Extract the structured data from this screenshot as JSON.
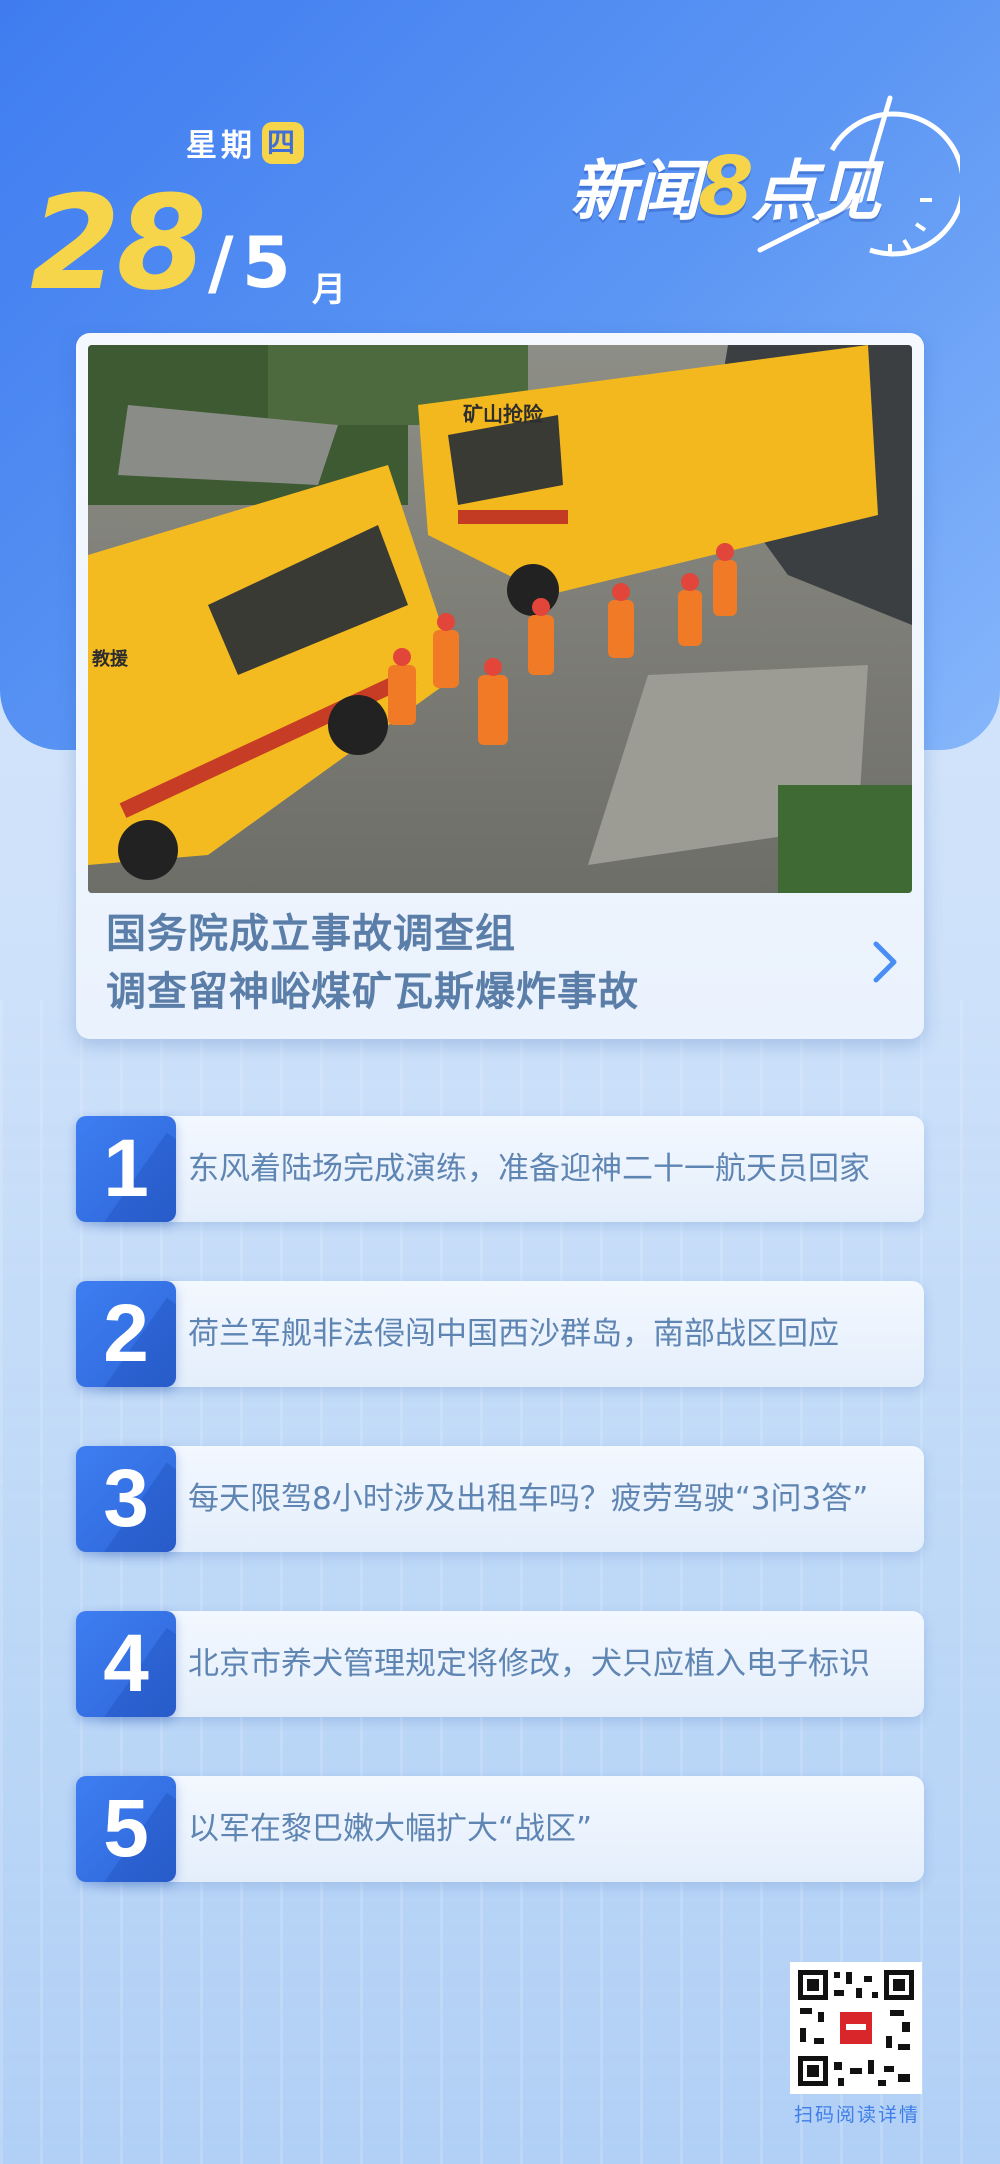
{
  "date": {
    "weekday_prefix": "星期",
    "weekday_day": "四",
    "day": "28",
    "slash": "/",
    "month": "5",
    "month_unit": "月"
  },
  "logo": {
    "part1": "新闻",
    "eight": "8",
    "part2": "点见"
  },
  "headline": {
    "line1": "国务院成立事故调查组",
    "line2": "调查留神峪煤矿瓦斯爆炸事故",
    "photo_van_label": "矿山抢险",
    "photo_van_label2": "教援"
  },
  "news": [
    {
      "num": "1",
      "text": "东风着陆场完成演练，准备迎神二十一航天员回家"
    },
    {
      "num": "2",
      "text": "荷兰军舰非法侵闯中国西沙群岛，南部战区回应"
    },
    {
      "num": "3",
      "text": "每天限驾8小时涉及出租车吗？疲劳驾驶“3问3答”"
    },
    {
      "num": "4",
      "text": "北京市养犬管理规定将修改，犬只应植入电子标识"
    },
    {
      "num": "5",
      "text": "以军在黎巴嫩大幅扩大“战区”"
    }
  ],
  "qr": {
    "caption": "扫码阅读详情"
  },
  "colors": {
    "accent_blue": "#3d7ef2",
    "accent_yellow": "#f7d54a",
    "headline_text": "#5b7ea9"
  }
}
